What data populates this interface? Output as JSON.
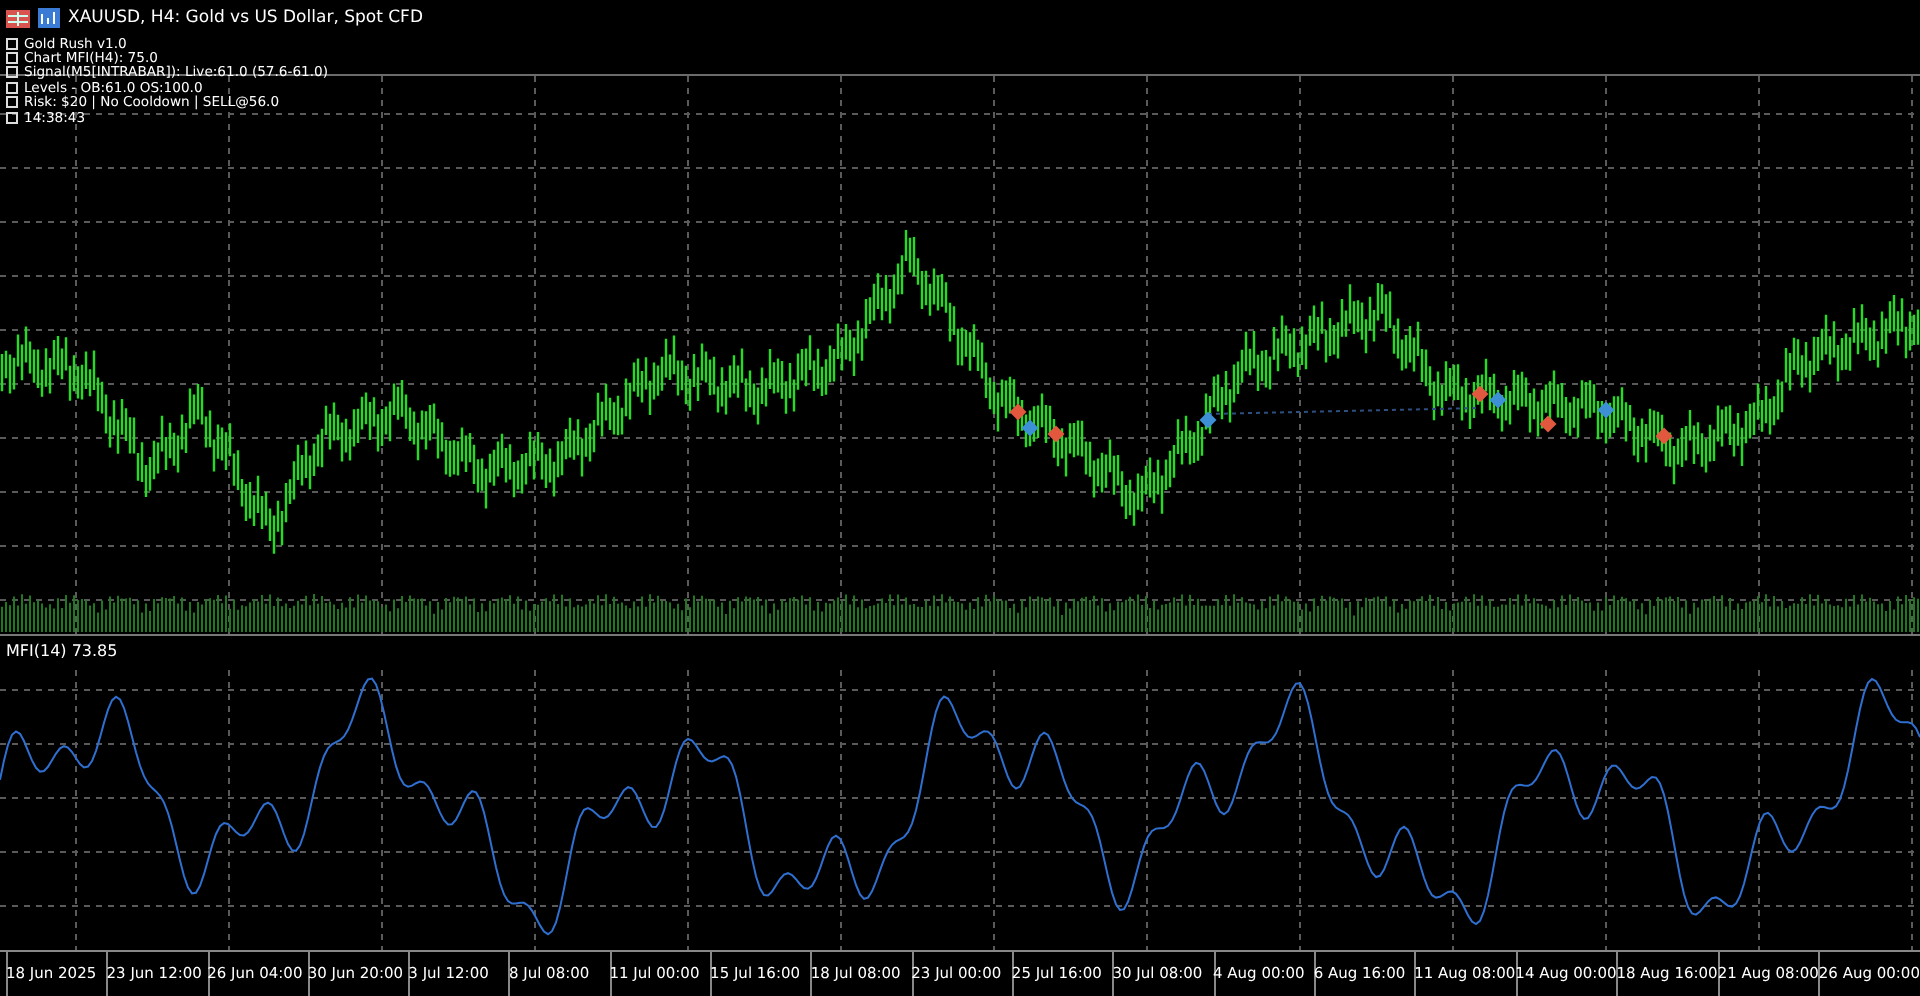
{
  "chart": {
    "title": "XAUUSD, H4:  Gold vs US Dollar, Spot CFD"
  },
  "info_lines": [
    "Gold Rush v1.0",
    "Chart MFI(H4): 75.0",
    "Signal(M5[INTRABAR]): Live:61.0 (57.6-61.0)",
    "Levels - OB:61.0 OS:100.0",
    "Risk: $20 | No Cooldown | SELL@56.0",
    "14:38:43"
  ],
  "indicator": {
    "label": "MFI(14) 73.85"
  },
  "time_axis": [
    "18 Jun 2025",
    "23 Jun 12:00",
    "26 Jun 04:00",
    "30 Jun 20:00",
    "3 Jul 12:00",
    "8 Jul 08:00",
    "11 Jul 00:00",
    "15 Jul 16:00",
    "18 Jul 08:00",
    "23 Jul 00:00",
    "25 Jul 16:00",
    "30 Jul 08:00",
    "4 Aug 00:00",
    "6 Aug 16:00",
    "11 Aug 08:00",
    "14 Aug 00:00",
    "18 Aug 16:00",
    "21 Aug 08:00",
    "26 Aug 00:00"
  ]
}
